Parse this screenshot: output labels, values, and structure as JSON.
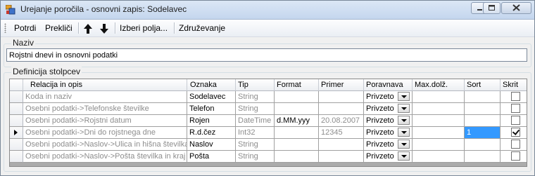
{
  "window": {
    "title": "Urejanje poročila - osnovni zapis: Sodelavec"
  },
  "toolbar": {
    "confirm": "Potrdi",
    "cancel": "Prekliči",
    "select_fields": "Izberi polja...",
    "grouping": "Združevanje"
  },
  "name_group": {
    "label": "Naziv",
    "value": "Rojstni dnevi in osnovni podatki"
  },
  "columns_group": {
    "label": "Definicija stolpcev"
  },
  "grid": {
    "headers": [
      "Relacija in opis",
      "Oznaka",
      "Tip",
      "Format",
      "Primer",
      "Poravnava",
      "Max.dolž.",
      "Sort",
      "Skrit"
    ],
    "rows": [
      {
        "relation": "Koda in naziv",
        "label": "Sodelavec",
        "type": "String",
        "format": "",
        "example": "",
        "align": "Privzeto",
        "maxlen": "",
        "sort": "",
        "hidden": false,
        "current": false
      },
      {
        "relation": "Osebni podatki->Telefonske številke",
        "label": "Telefon",
        "type": "String",
        "format": "",
        "example": "",
        "align": "Privzeto",
        "maxlen": "",
        "sort": "",
        "hidden": false,
        "current": false
      },
      {
        "relation": "Osebni podatki->Rojstni datum",
        "label": "Rojen",
        "type": "DateTime",
        "format": "d.MM.yyy",
        "example": "20.08.2007",
        "align": "Privzeto",
        "maxlen": "",
        "sort": "",
        "hidden": false,
        "current": false
      },
      {
        "relation": "Osebni podatki->Dni do rojstnega dne",
        "label": "R.d.čez",
        "type": "Int32",
        "format": "",
        "example": "12345",
        "align": "Privzeto",
        "maxlen": "",
        "sort": "1",
        "hidden": true,
        "current": true
      },
      {
        "relation": "Osebni podatki->Naslov->Ulica in hišna številka",
        "label": "Naslov",
        "type": "String",
        "format": "",
        "example": "",
        "align": "Privzeto",
        "maxlen": "",
        "sort": "",
        "hidden": false,
        "current": false
      },
      {
        "relation": "Osebni podatki->Naslov->Pošta številka in kraj",
        "label": "Pošta",
        "type": "String",
        "format": "",
        "example": "",
        "align": "Privzeto",
        "maxlen": "",
        "sort": "",
        "hidden": false,
        "current": false
      }
    ]
  }
}
